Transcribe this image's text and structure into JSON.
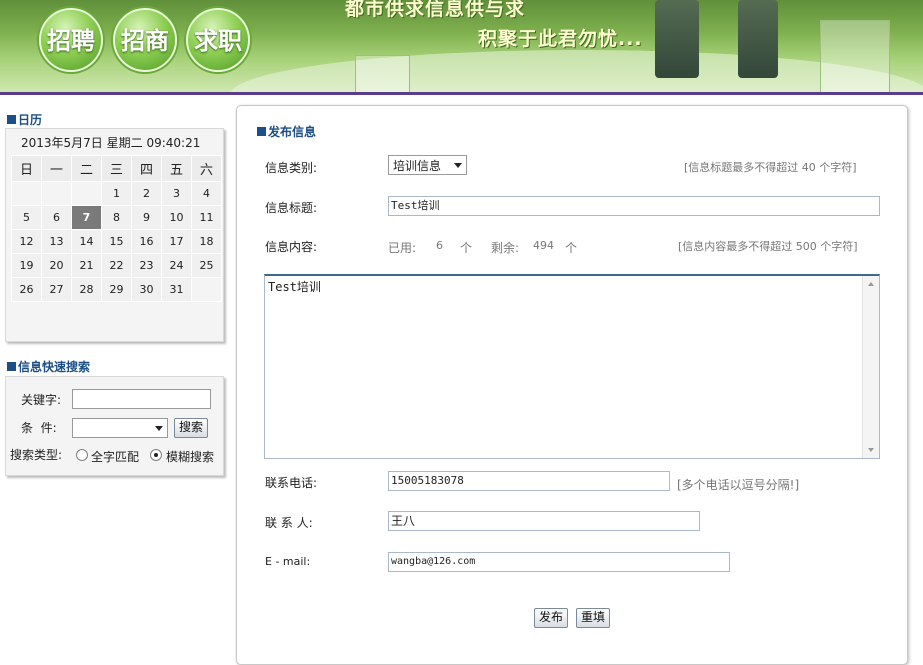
{
  "banner": {
    "buttons": [
      "招聘",
      "招商",
      "求职"
    ],
    "slogan_line1": "都市供求信息供与求",
    "slogan_line2": "积聚于此君勿忧..."
  },
  "calendar": {
    "title": "日历",
    "datetime": "2013年5月7日 星期二 09:40:21",
    "weekdays": [
      "日",
      "一",
      "二",
      "三",
      "四",
      "五",
      "六"
    ],
    "weeks": [
      [
        "",
        "",
        "",
        "1",
        "2",
        "3",
        "4"
      ],
      [
        "5",
        "6",
        "7",
        "8",
        "9",
        "10",
        "11"
      ],
      [
        "12",
        "13",
        "14",
        "15",
        "16",
        "17",
        "18"
      ],
      [
        "19",
        "20",
        "21",
        "22",
        "23",
        "24",
        "25"
      ],
      [
        "26",
        "27",
        "28",
        "29",
        "30",
        "31",
        ""
      ]
    ],
    "today": "7"
  },
  "quick_search": {
    "title": "信息快速搜索",
    "keyword_label": "关键字:",
    "keyword_value": "",
    "condition_label": "条  件:",
    "condition_value": "",
    "search_button": "搜索",
    "type_label": "搜索类型:",
    "type_options": [
      "全字匹配",
      "模糊搜索"
    ],
    "type_selected": "模糊搜索"
  },
  "publish": {
    "title": "发布信息",
    "category_label": "信息类别:",
    "category_value": "培训信息",
    "title_hint": "[信息标题最多不得超过 40 个字符]",
    "info_title_label": "信息标题:",
    "info_title_value": "Test培训",
    "content_label": "信息内容:",
    "used_label": "已用:",
    "used_count": "6",
    "unit": "个",
    "remain_label": "剩余:",
    "remain_count": "494",
    "content_hint": "[信息内容最多不得超过 500 个字符]",
    "content_value": "Test培训",
    "phone_label": "联系电话:",
    "phone_value": "15005183078",
    "phone_hint": "[多个电话以逗号分隔!]",
    "contact_label": "联 系 人:",
    "contact_value": "王八",
    "email_label": "E - mail:",
    "email_value": "wangba@126.com",
    "submit_button": "发布",
    "reset_button": "重填"
  }
}
